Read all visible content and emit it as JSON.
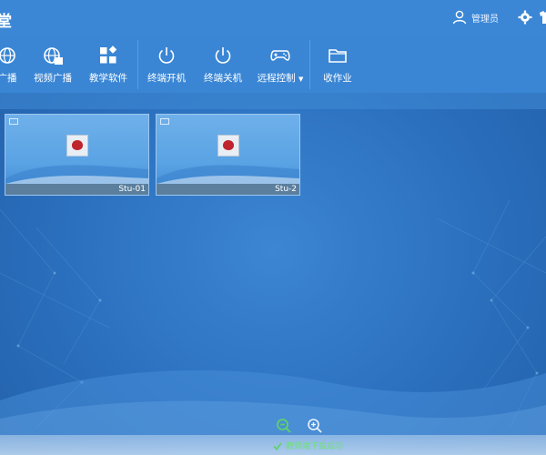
{
  "window": {
    "title": "堂"
  },
  "header": {
    "user_label": "管理员",
    "user_icon": "user-icon",
    "settings_icon": "gear-icon"
  },
  "toolbar": {
    "items": [
      {
        "label": "广播",
        "icon": "globe-icon"
      },
      {
        "label": "视频广播",
        "icon": "globe-video-icon"
      },
      {
        "label": "教学软件",
        "icon": "apps-icon"
      },
      {
        "label": "终端开机",
        "icon": "power-icon"
      },
      {
        "label": "终端关机",
        "icon": "power-icon"
      },
      {
        "label": "远程控制",
        "icon": "gamepad-icon"
      },
      {
        "label": "收作业",
        "icon": "folder-icon"
      }
    ]
  },
  "terminals": [
    {
      "name": "Stu-01"
    },
    {
      "name": "Stu-2"
    }
  ],
  "footer": {
    "status_text": "教师端下载成功"
  },
  "colors": {
    "accent": "#3a86d5",
    "status_green": "#6fe07b"
  }
}
